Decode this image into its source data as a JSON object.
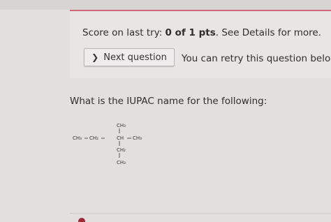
{
  "score": {
    "prefix": "Score on last try: ",
    "value": "0 of 1 pts",
    "suffix": ". See Details for more."
  },
  "actions": {
    "next_question_label": "Next question",
    "retry_text": "You can retry this question below"
  },
  "question": {
    "prompt": "What is the IUPAC name for the following:"
  },
  "molecule": {
    "top_substituent": "CH₃",
    "main_chain": [
      "CH₃",
      "CH₂",
      "CH",
      "CH₃"
    ],
    "lower_chain": [
      "CH₂",
      "CH₃"
    ]
  },
  "icons": {
    "chevron": "chevron-right-icon"
  },
  "colors": {
    "accent": "#d06a78",
    "background": "#e2e0df"
  }
}
